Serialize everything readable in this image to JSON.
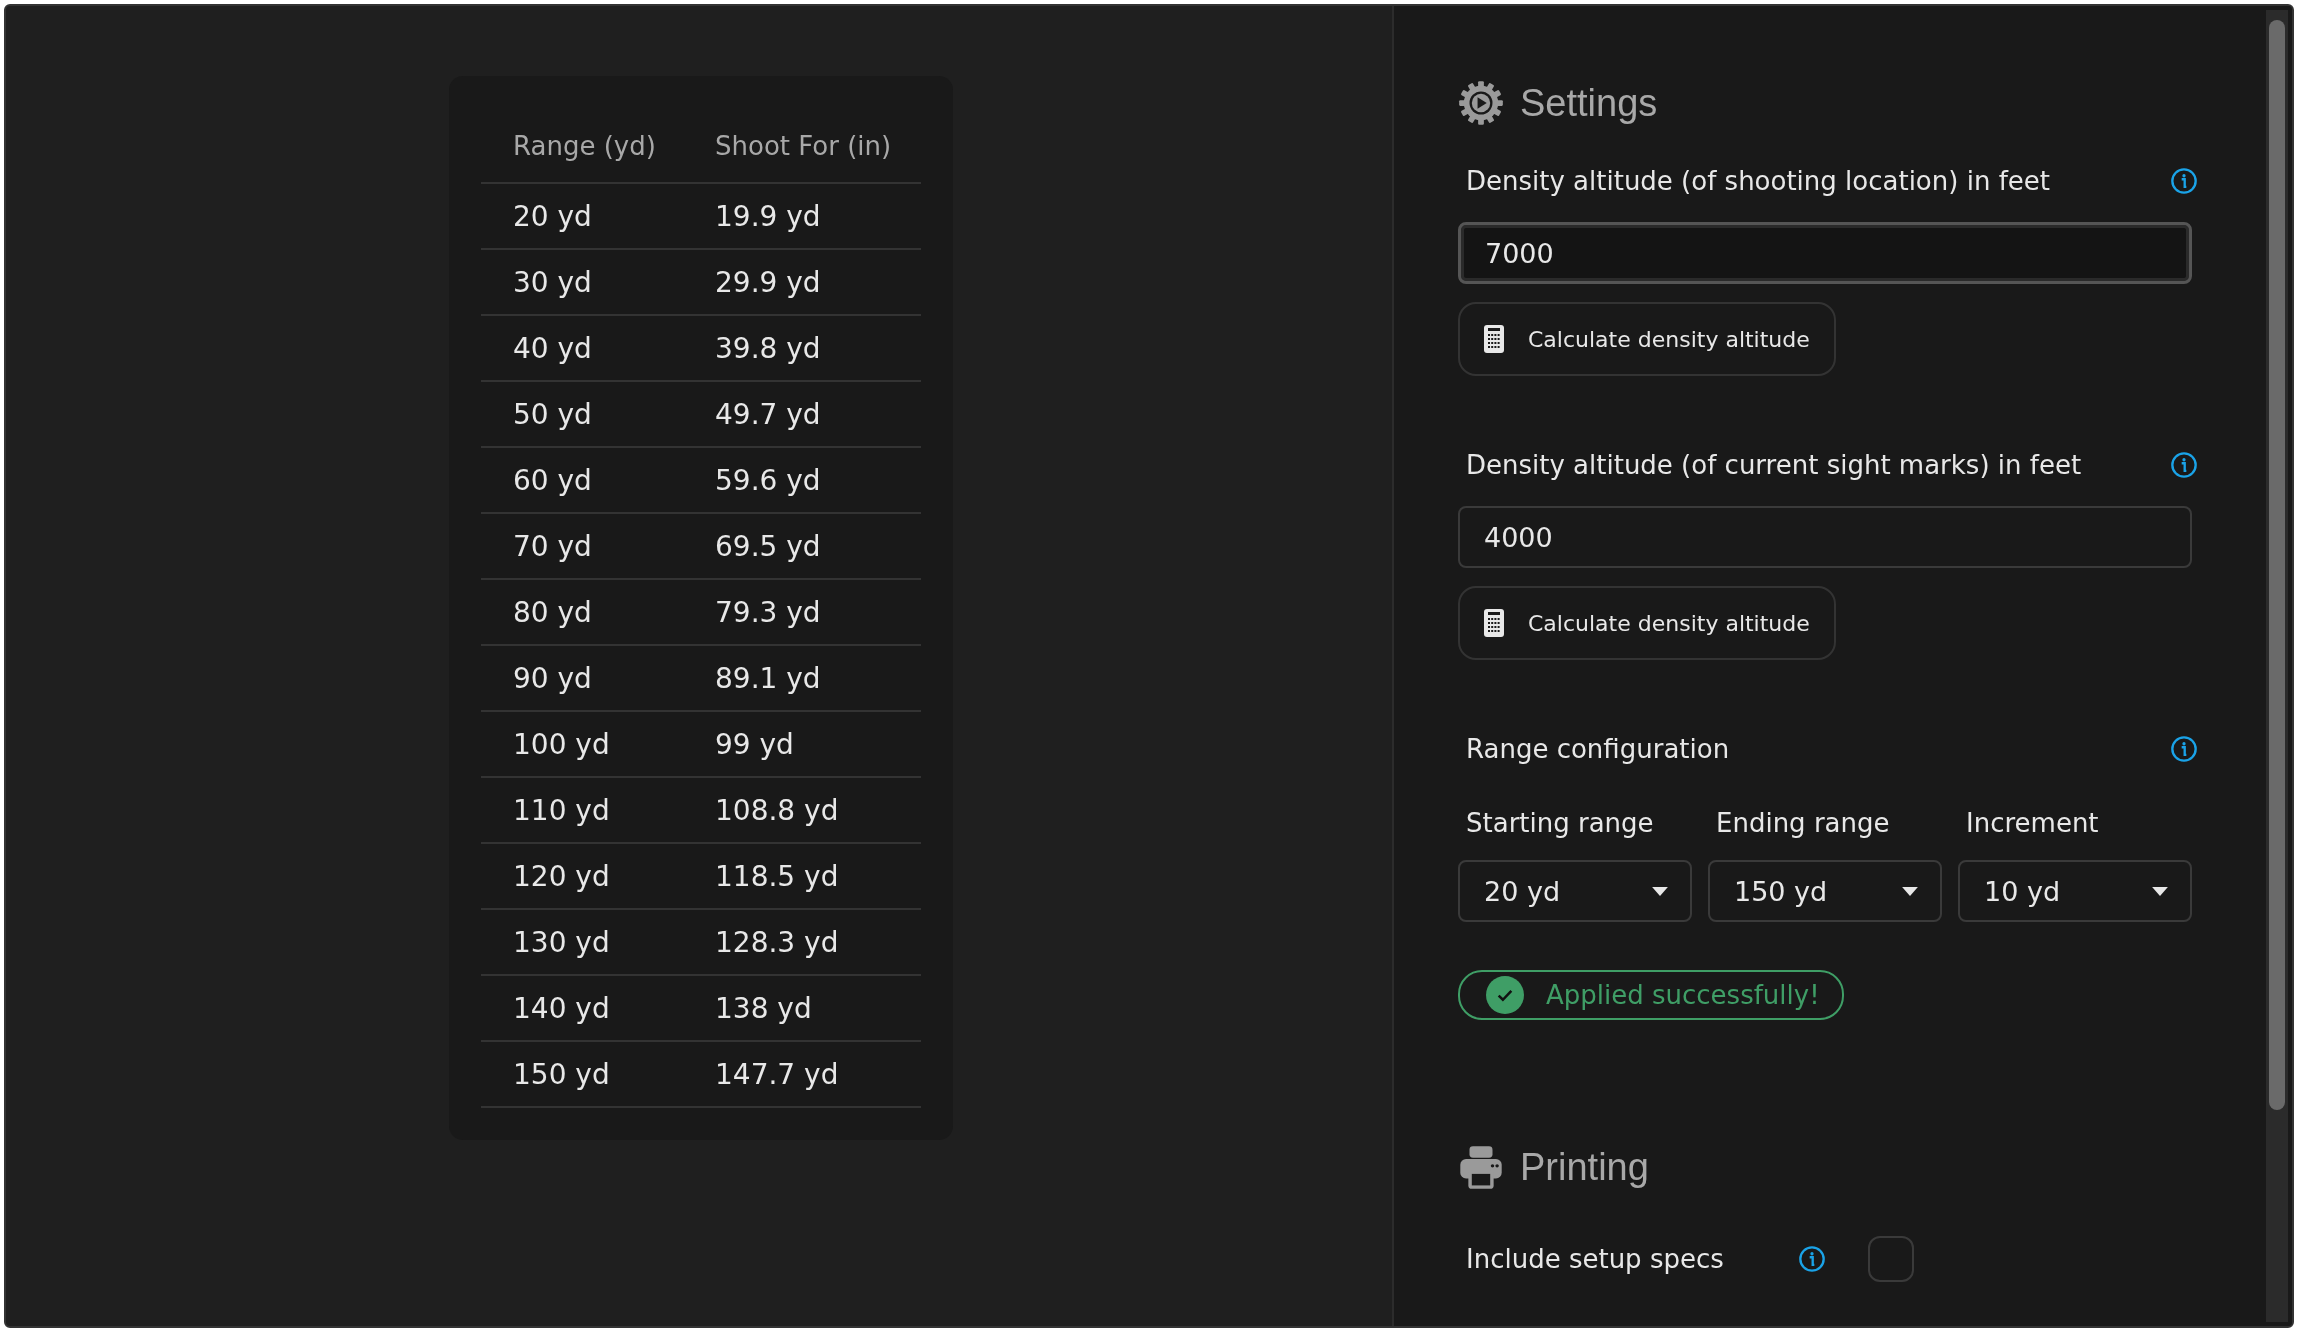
{
  "table": {
    "columns": [
      "Range (yd)",
      "Shoot For (in)"
    ],
    "rows": [
      [
        "20 yd",
        "19.9 yd"
      ],
      [
        "30 yd",
        "29.9 yd"
      ],
      [
        "40 yd",
        "39.8 yd"
      ],
      [
        "50 yd",
        "49.7 yd"
      ],
      [
        "60 yd",
        "59.6 yd"
      ],
      [
        "70 yd",
        "69.5 yd"
      ],
      [
        "80 yd",
        "79.3 yd"
      ],
      [
        "90 yd",
        "89.1 yd"
      ],
      [
        "100 yd",
        "99 yd"
      ],
      [
        "110 yd",
        "108.8 yd"
      ],
      [
        "120 yd",
        "118.5 yd"
      ],
      [
        "130 yd",
        "128.3 yd"
      ],
      [
        "140 yd",
        "138 yd"
      ],
      [
        "150 yd",
        "147.7 yd"
      ]
    ]
  },
  "settings": {
    "title": "Settings",
    "fields": [
      {
        "label": "Density altitude (of shooting location) in feet",
        "value": "7000",
        "focused": true,
        "button": "Calculate density altitude"
      },
      {
        "label": "Density altitude (of current sight marks) in feet",
        "value": "4000",
        "focused": false,
        "button": "Calculate density altitude"
      }
    ],
    "range": {
      "label": "Range configuration",
      "selects": [
        {
          "label": "Starting range",
          "value": "20 yd"
        },
        {
          "label": "Ending range",
          "value": "150 yd"
        },
        {
          "label": "Increment",
          "value": "10 yd"
        }
      ]
    },
    "status": "Applied successfully!"
  },
  "printing": {
    "title": "Printing",
    "options": [
      {
        "label": "Include setup specs",
        "checked": false
      }
    ]
  }
}
